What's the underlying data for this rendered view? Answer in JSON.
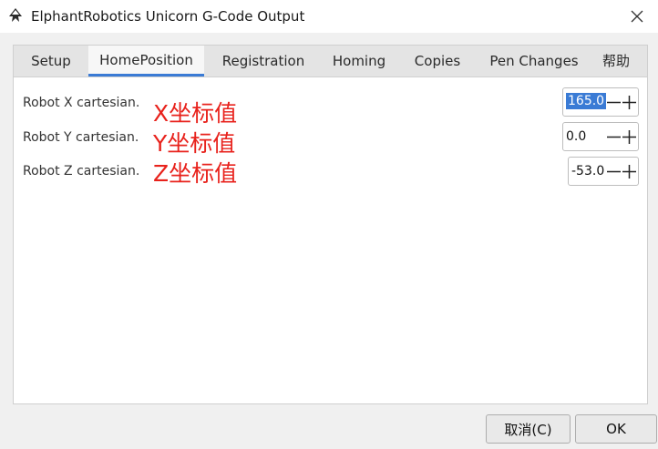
{
  "window": {
    "title": "ElphantRobotics Unicorn G-Code Output",
    "app_icon": "inkscape-logo-icon",
    "close_icon": "close-icon"
  },
  "tabs": [
    {
      "label": "Setup",
      "active": false
    },
    {
      "label": "HomePosition",
      "active": true
    },
    {
      "label": "Registration",
      "active": false
    },
    {
      "label": "Homing",
      "active": false
    },
    {
      "label": "Copies",
      "active": false
    },
    {
      "label": "Pen Changes",
      "active": false
    },
    {
      "label": "帮助",
      "active": false
    }
  ],
  "fields": [
    {
      "label": "Robot X cartesian.",
      "annotation": "X坐标值",
      "value": "165.0",
      "selected": true
    },
    {
      "label": "Robot Y cartesian.",
      "annotation": "Y坐标值",
      "value": "0.0",
      "selected": false
    },
    {
      "label": "Robot Z cartesian.",
      "annotation": "Z坐标值",
      "value": "-53.0",
      "selected": false
    }
  ],
  "buttons": {
    "cancel": "取消(C)",
    "ok": "OK"
  },
  "colors": {
    "accent": "#3a7bd5",
    "annotation": "#e8221c"
  }
}
